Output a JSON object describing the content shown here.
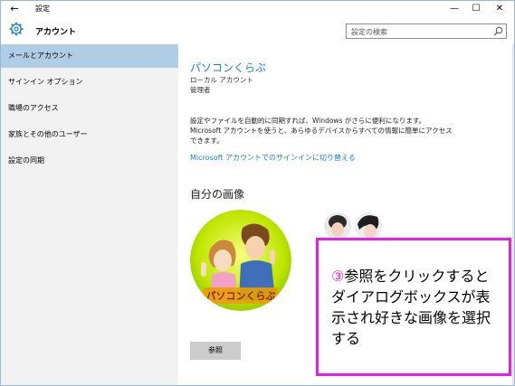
{
  "window": {
    "title": "設定",
    "back_glyph": "←",
    "min_glyph": "—",
    "max_glyph": "☐",
    "close_glyph": "✕"
  },
  "header": {
    "title": "アカウント",
    "search_placeholder": "設定の検索"
  },
  "sidebar": {
    "items": [
      {
        "label": "メールとアカウント",
        "active": true
      },
      {
        "label": "サインイン オプション",
        "active": false
      },
      {
        "label": "職場のアクセス",
        "active": false
      },
      {
        "label": "家族とその他のユーザー",
        "active": false
      },
      {
        "label": "設定の同期",
        "active": false
      }
    ]
  },
  "account": {
    "name": "パソコンくらぶ",
    "type": "ローカル アカウント",
    "role": "管理者",
    "description": "設定やファイルを自動的に同期すれば、Windows がさらに便利になります。Microsoft アカウントを使うと、あらゆるデバイスからすべての情報に簡単にアクセスできます。",
    "switch_link": "Microsoft アカウントでのサインインに切り替える"
  },
  "picture": {
    "section_title": "自分の画像",
    "avatar_caption": "パソコンくらぶ",
    "browse_label": "参照"
  },
  "callout": {
    "number": "③",
    "text": "参照をクリックするとダイアログボックスが表示され好きな画像を選択する"
  },
  "colors": {
    "accent": "#1a7fd1",
    "active_nav": "#b0cde6",
    "callout_border": "#e61ee6"
  }
}
